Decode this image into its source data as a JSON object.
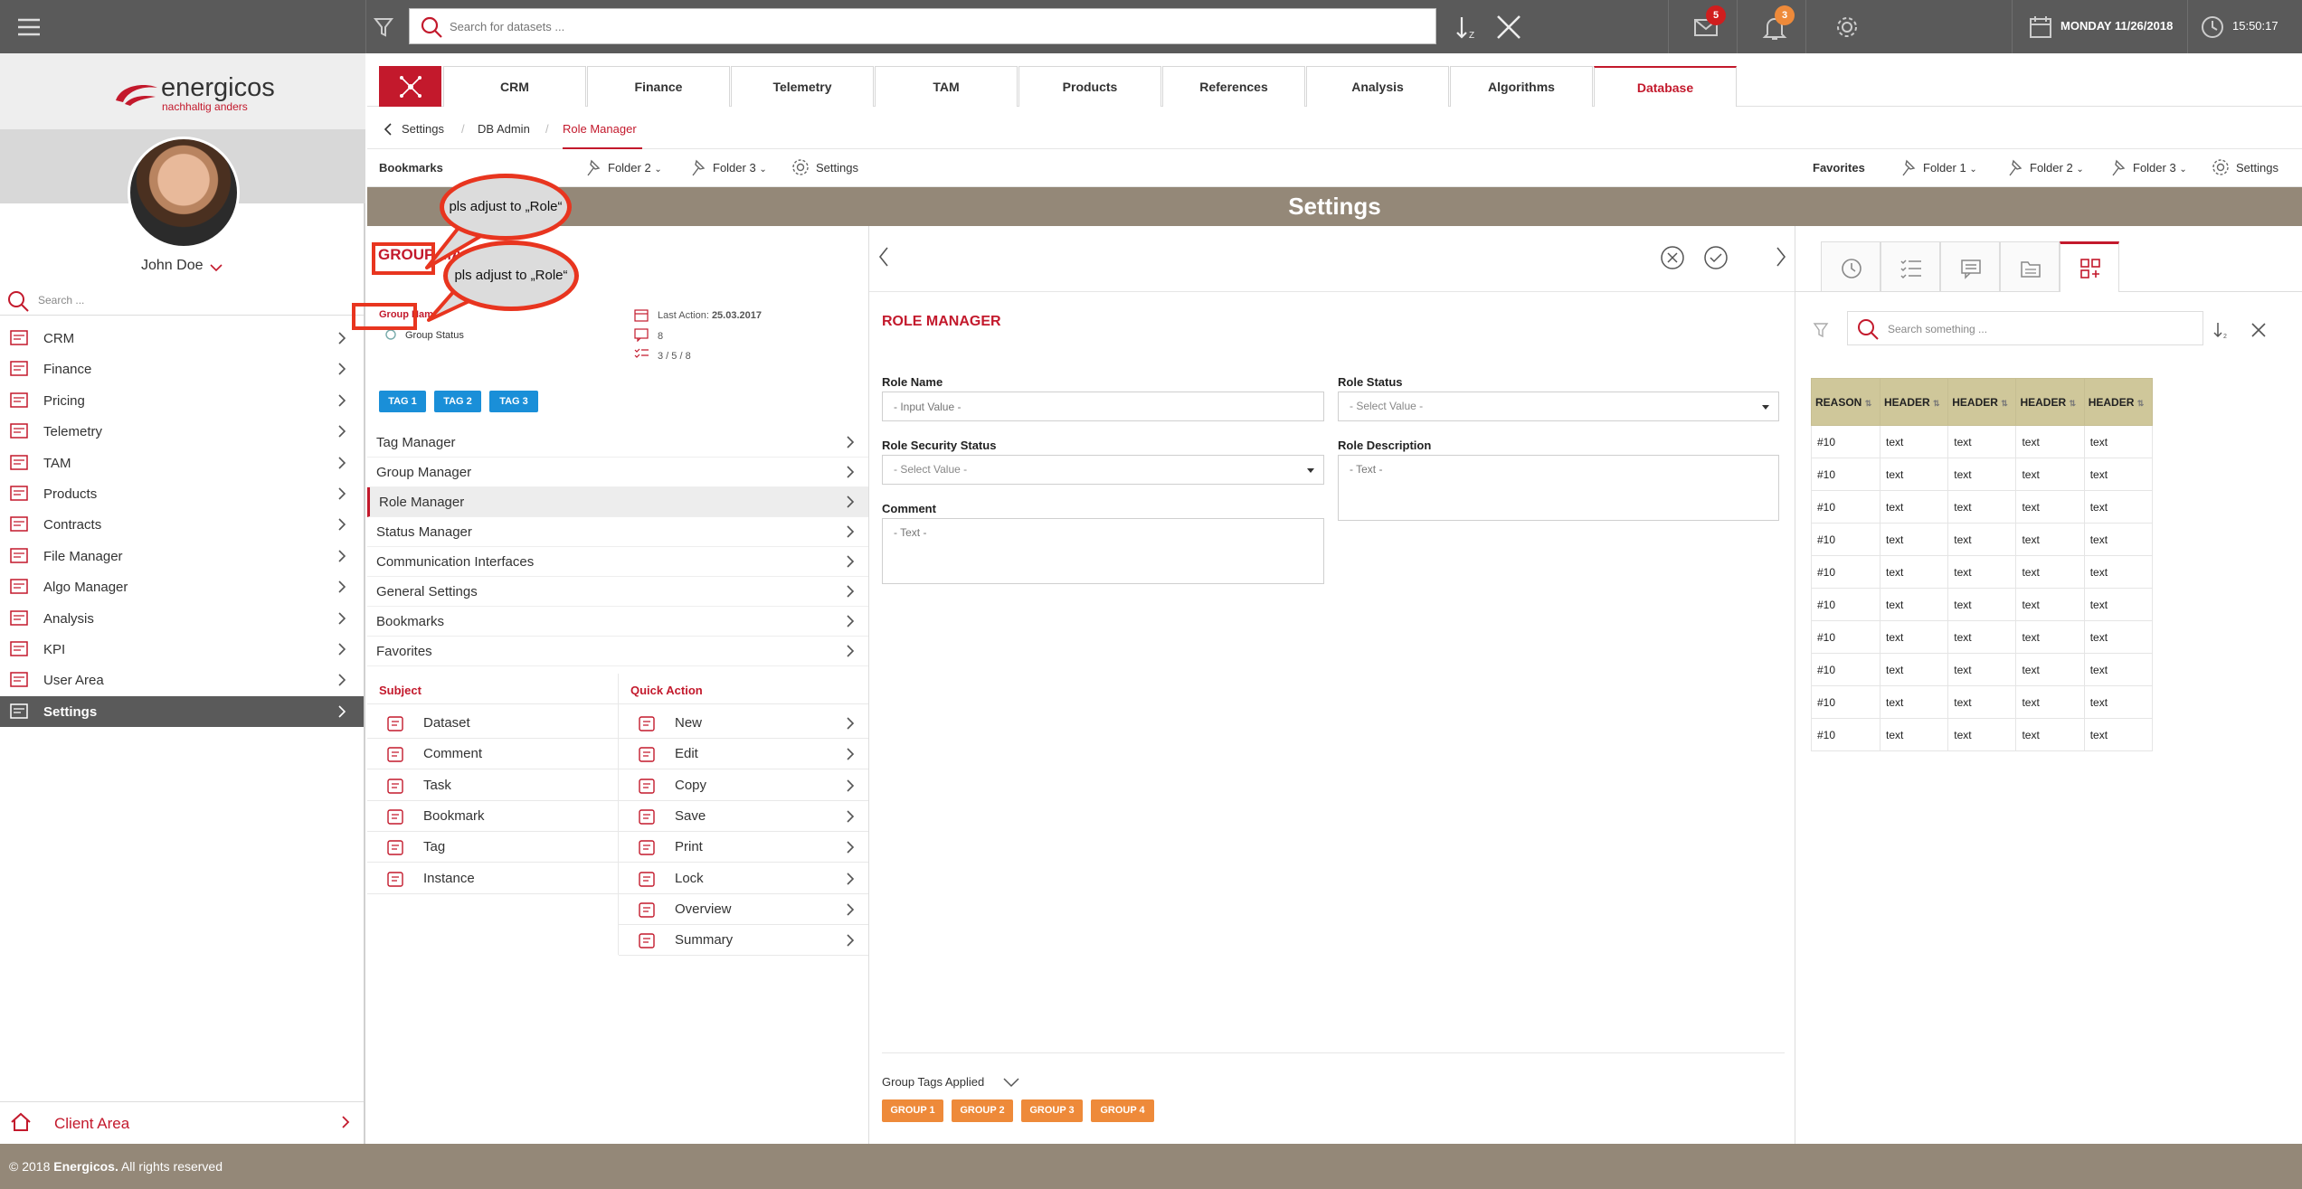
{
  "topbar": {
    "search_placeholder": "Search for datasets ...",
    "mail_count": "5",
    "notif_count": "3",
    "date": "MONDAY 11/26/2018",
    "time": "15:50:17"
  },
  "brand": {
    "name": "energicos",
    "tagline": "nachhaltig anders",
    "color": "#c3192c"
  },
  "user": {
    "name": "John Doe"
  },
  "sidebar": {
    "search_placeholder": "Search ...",
    "items": [
      {
        "label": "CRM",
        "icon": "crm-icon"
      },
      {
        "label": "Finance",
        "icon": "finance-icon"
      },
      {
        "label": "Pricing",
        "icon": "pricing-icon"
      },
      {
        "label": "Telemetry",
        "icon": "telemetry-icon"
      },
      {
        "label": "TAM",
        "icon": "tam-icon"
      },
      {
        "label": "Products",
        "icon": "products-icon"
      },
      {
        "label": "Contracts",
        "icon": "contracts-icon"
      },
      {
        "label": "File Manager",
        "icon": "file-manager-icon"
      },
      {
        "label": "Algo Manager",
        "icon": "algo-manager-icon"
      },
      {
        "label": "Analysis",
        "icon": "analysis-icon"
      },
      {
        "label": "KPI",
        "icon": "kpi-icon"
      },
      {
        "label": "User Area",
        "icon": "user-area-icon"
      },
      {
        "label": "Settings",
        "icon": "settings-icon"
      }
    ],
    "client_area": "Client Area"
  },
  "nav_tabs": [
    "CRM",
    "Finance",
    "Telemetry",
    "TAM",
    "Products",
    "References",
    "Analysis",
    "Algorithms",
    "Database"
  ],
  "breadcrumb": [
    "Settings",
    "DB Admin",
    "Role Manager"
  ],
  "bookmarks": {
    "label": "Bookmarks",
    "items": [
      "Folder 2",
      "Folder 3",
      "Settings"
    ]
  },
  "favorites": {
    "label": "Favorites",
    "items": [
      "Folder 1",
      "Folder 2",
      "Folder 3",
      "Settings"
    ]
  },
  "section_title": "Settings",
  "group_panel": {
    "title_part1": "GROUP",
    "title_part2": "MA",
    "group_name": "Group Name",
    "group_status": "Group Status",
    "last_action_label": "Last Action:",
    "last_action_date": "25.03.2017",
    "comments": "8",
    "tasks": "3 / 5 / 8",
    "tags": [
      "TAG 1",
      "TAG 2",
      "TAG 3"
    ],
    "menu": [
      "Tag Manager",
      "Group Manager",
      "Role Manager",
      "Status Manager",
      "Communication Interfaces",
      "General Settings",
      "Bookmarks",
      "Favorites"
    ],
    "subject_header": "Subject",
    "quick_action_header": "Quick Action",
    "subjects": [
      "Dataset",
      "Comment",
      "Task",
      "Bookmark",
      "Tag",
      "Instance"
    ],
    "quick_actions": [
      "New",
      "Edit",
      "Copy",
      "Save",
      "Print",
      "Lock",
      "Overview",
      "Summary"
    ]
  },
  "form": {
    "title": "ROLE MANAGER",
    "role_name_label": "Role Name",
    "role_name_placeholder": "- Input Value -",
    "role_status_label": "Role Status",
    "role_status_value": "- Select Value -",
    "role_security_label": "Role Security Status",
    "role_security_value": "- Select Value -",
    "role_desc_label": "Role Description",
    "role_desc_placeholder": "- Text -",
    "comment_label": "Comment",
    "comment_placeholder": "- Text -",
    "group_tags_label": "Group Tags Applied",
    "group_tags": [
      "GROUP 1",
      "GROUP 2",
      "GROUP 3",
      "GROUP 4"
    ]
  },
  "right_panel": {
    "search_placeholder": "Search something ...",
    "headers": [
      "REASON",
      "HEADER",
      "HEADER",
      "HEADER",
      "HEADER"
    ],
    "rows": [
      [
        "#10",
        "text",
        "text",
        "text",
        "text"
      ],
      [
        "#10",
        "text",
        "text",
        "text",
        "text"
      ],
      [
        "#10",
        "text",
        "text",
        "text",
        "text"
      ],
      [
        "#10",
        "text",
        "text",
        "text",
        "text"
      ],
      [
        "#10",
        "text",
        "text",
        "text",
        "text"
      ],
      [
        "#10",
        "text",
        "text",
        "text",
        "text"
      ],
      [
        "#10",
        "text",
        "text",
        "text",
        "text"
      ],
      [
        "#10",
        "text",
        "text",
        "text",
        "text"
      ],
      [
        "#10",
        "text",
        "text",
        "text",
        "text"
      ],
      [
        "#10",
        "text",
        "text",
        "text",
        "text"
      ]
    ]
  },
  "annotations": [
    "pls adjust to „Role“",
    "pls adjust to „Role“"
  ],
  "footer": {
    "prefix": "© 2018 ",
    "company": "Energicos.",
    "suffix": " All rights reserved"
  }
}
